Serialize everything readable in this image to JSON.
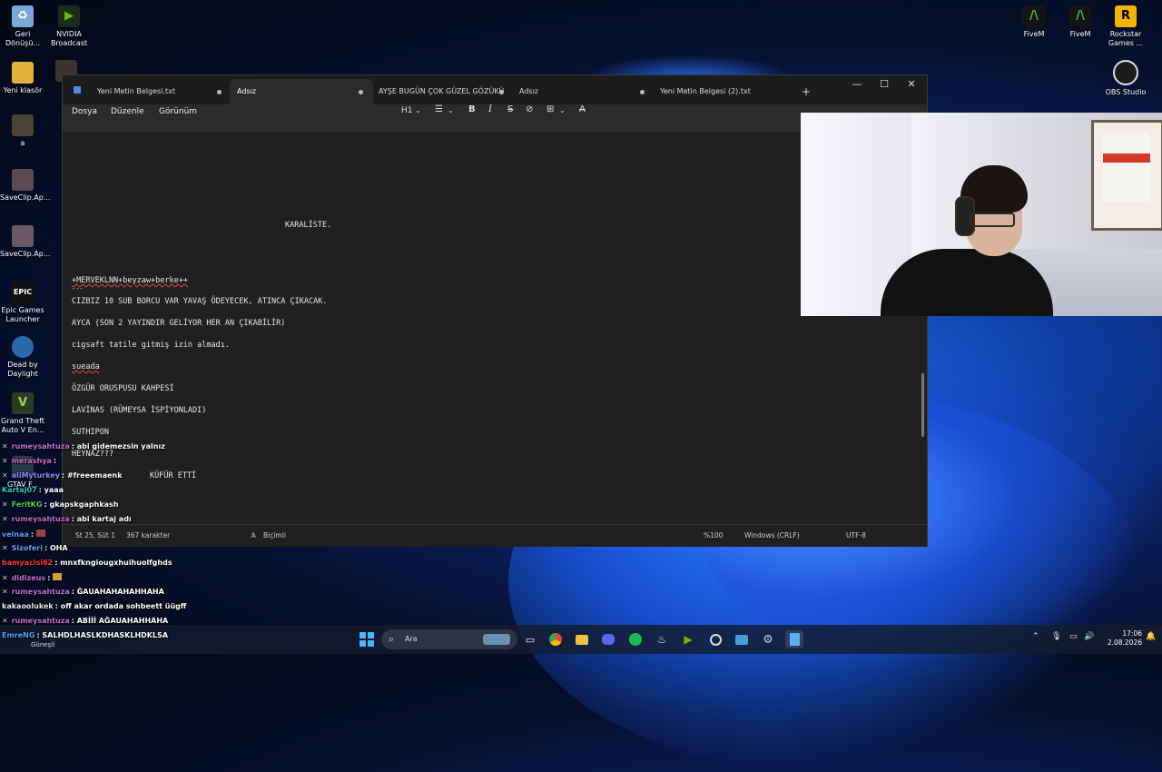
{
  "desktop": {
    "left_icons": [
      {
        "label": "Geri Dönüşü...",
        "icon": "recycle-bin-icon"
      },
      {
        "label": "NVIDIA Broadcast",
        "icon": "nvidia-broadcast-icon"
      },
      {
        "label": "Yeni klasör",
        "icon": "folder-icon"
      },
      {
        "label": "a",
        "icon": "image-file-icon"
      },
      {
        "label": "SaveClip.Ap...",
        "icon": "image-file-icon"
      },
      {
        "label": "SaveClip.Ap...",
        "icon": "image-file-icon"
      },
      {
        "label": "Epic Games Launcher",
        "icon": "epic-games-icon"
      },
      {
        "label": "Dead by Daylight",
        "icon": "dead-by-daylight-icon"
      },
      {
        "label": "Grand Theft Auto V En...",
        "icon": "gta-v-icon"
      },
      {
        "label": "GTAV F...",
        "icon": "game-icon"
      }
    ],
    "right_icons": [
      {
        "label": "FiveM",
        "icon": "fivem-icon"
      },
      {
        "label": "FiveM",
        "icon": "fivem-icon"
      },
      {
        "label": "Rockstar Games ...",
        "icon": "rockstar-icon"
      },
      {
        "label": "OBS Studio",
        "icon": "obs-icon"
      }
    ]
  },
  "notepad": {
    "tabs": [
      {
        "label": "Yeni Metin Belgesi.txt",
        "modified": true
      },
      {
        "label": "Adsız",
        "modified": true,
        "active": true
      },
      {
        "label": "AYŞE BUGÜN ÇOK GÜZEL GÖZÜKÜ",
        "modified": true
      },
      {
        "label": "Adsız",
        "modified": true
      },
      {
        "label": "Yeni Metin Belgesi (2).txt",
        "modified": false
      }
    ],
    "new_tab": "+",
    "window_controls": {
      "minimize": "—",
      "maximize": "☐",
      "close": "✕"
    },
    "menu": {
      "file": "Dosya",
      "edit": "Düzenle",
      "view": "Görünüm"
    },
    "toolbar": {
      "heading": "H1",
      "list": "☰",
      "bold": "B",
      "italic": "I",
      "strike": "S",
      "link": "⊘",
      "table": "⊞",
      "clear": "A"
    },
    "lines": [
      "KARALİSTE.",
      "+MERVEKLNN+beyzaw+berke++",
      "---",
      "CIZBIZ 10 SUB BORCU VAR YAVAŞ ÖDEYECEK, ATINCA ÇIKACAK.",
      "AYCA (SON 2 YAYINDIR GELİYOR HER AN ÇIKABİLİR)",
      "cigsaft tatile gitmiş izin almadı.",
      "sueada",
      "ÖZGÜR ORUSPUSU KAHPESİ",
      "LAVİNAS (RÜMEYSA İSPİYONLADI)",
      "SUTHIPON",
      "HEYNAZ???",
      "KÜFÜR ETTİ"
    ],
    "status": {
      "position": "St 25, Süt 1",
      "chars": "367 karakter",
      "format": "Biçimli",
      "zoom": "%100",
      "line_ending": "Windows (CRLF)",
      "encoding": "UTF-8"
    }
  },
  "chat": [
    {
      "user": "rumeysahtuza",
      "color": "#c86bd6",
      "message": ": abi gidemezsin yalnız"
    },
    {
      "user": "merashya",
      "color": "#d86ad0",
      "message": ":"
    },
    {
      "user": "aliMyturkey",
      "color": "#8a8aff",
      "message": ": #freeemaenk"
    },
    {
      "user": "Kartaj07",
      "color": "#2fc9c4",
      "message": ": yaaa"
    },
    {
      "user": "FeritKG",
      "color": "#4fd04f",
      "message": ": gkapskgaphkash"
    },
    {
      "user": "rumeysahtuza",
      "color": "#c86bd6",
      "message": ": abi kartaj adı"
    },
    {
      "user": "velnaa",
      "color": "#5aa0ff",
      "message": ":"
    },
    {
      "user": "Sizoferi",
      "color": "#6aa0ff",
      "message": ": OHA"
    },
    {
      "user": "bamyacisi62",
      "color": "#ff3b3b",
      "message": ": mnxfkngiougxhuihuolfghds"
    },
    {
      "user": "didizeus",
      "color": "#c86bd6",
      "message": ":"
    },
    {
      "user": "rumeysahtuza",
      "color": "#c86bd6",
      "message": ": ĞAUAHAHAHAHHAHA"
    },
    {
      "user": "kakaoolukek",
      "color": "#e7e7e7",
      "message": ": off akar ordada sohbeett üügff"
    },
    {
      "user": "rumeysahtuza",
      "color": "#c86bd6",
      "message": ": ABİİİ AĞAUAHAHHAHA"
    },
    {
      "user": "EmreNG",
      "color": "#4fa0ff",
      "message": ": SALHDLHASLKDHASKLHDKLSA"
    }
  ],
  "taskbar": {
    "weather": "Güneşli",
    "search_placeholder": "Ara",
    "time": "17:06",
    "date": "2.08.2026"
  }
}
